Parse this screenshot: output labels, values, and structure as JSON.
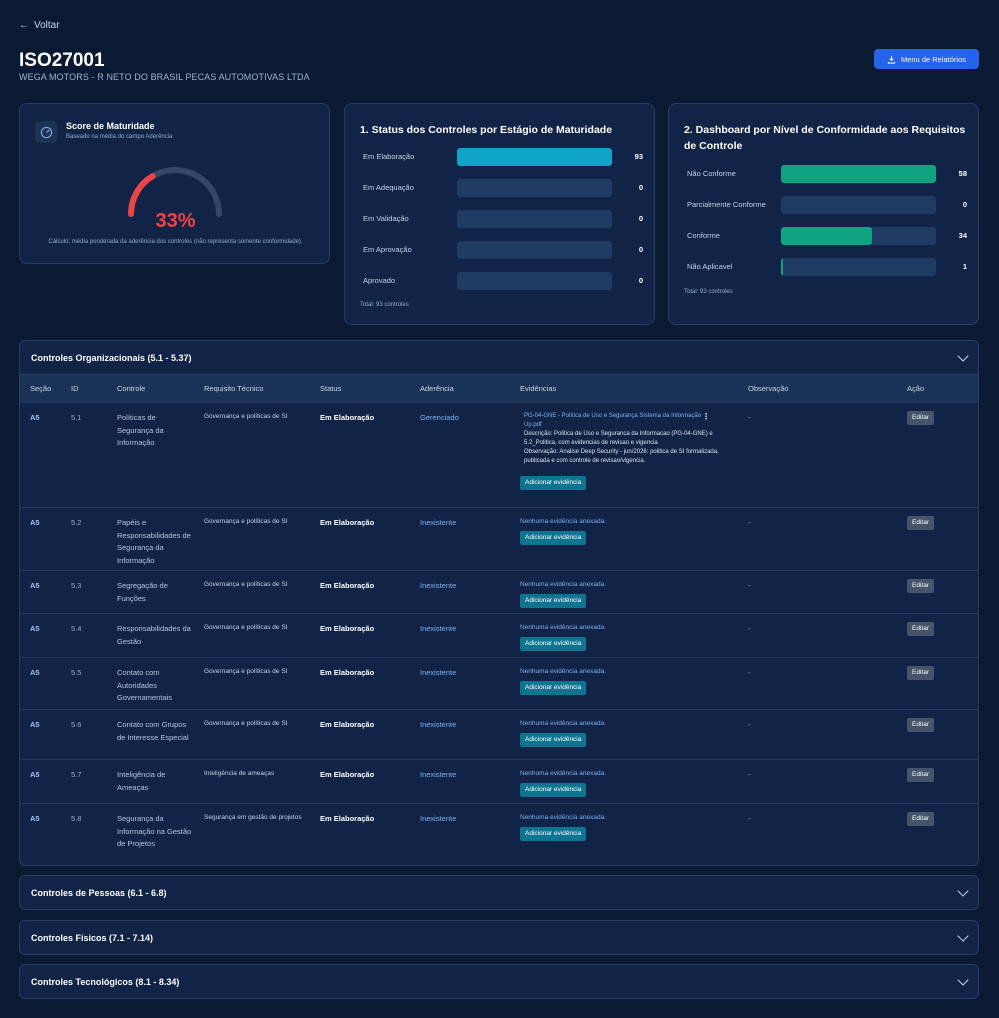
{
  "nav": {
    "back_label": "Voltar"
  },
  "header": {
    "title": "ISO27001",
    "company": "WEGA MOTORS - R NETO DO BRASIL PECAS AUTOMOTIVAS LTDA",
    "report_button": "Menu de Relatórios"
  },
  "score": {
    "title": "Score de Maturidade",
    "subtitle": "Baseado na média do campo Aderência",
    "value": "33%",
    "value_fraction": 0.33,
    "note": "Cálculo: média ponderada da aderência dos controles (não representa somente conformidade).",
    "color": "#ef4444"
  },
  "status_chart": {
    "title": "1. Status dos Controles por Estágio de Maturidade",
    "total": "Total: 93 controles",
    "max": 93,
    "color": "#0ea5c9",
    "rows": [
      {
        "label": "Em Elaboração",
        "value": 93
      },
      {
        "label": "Em Adequação",
        "value": 0
      },
      {
        "label": "Em Validação",
        "value": 0
      },
      {
        "label": "Em Aprovação",
        "value": 0
      },
      {
        "label": "Aprovado",
        "value": 0
      }
    ]
  },
  "conformity_chart": {
    "title_line1": "2. Dashboard por Nível de Conformidade aos Requisitos",
    "title_line2": "de Controle",
    "total": "Total: 93 controles",
    "max": 58,
    "color": "#10a37f",
    "rows": [
      {
        "label": "Não Conforme",
        "value": 58
      },
      {
        "label": "Parcialmente Conforme",
        "value": 0
      },
      {
        "label": "Conforme",
        "value": 34
      },
      {
        "label": "Não Aplicavel",
        "value": 1
      }
    ]
  },
  "sections": {
    "org": {
      "title": "Controles Organizacionais (5.1 - 5.37)",
      "columns": [
        "Seção",
        "ID",
        "Controle",
        "Requisito Técnico",
        "Status",
        "Aderência",
        "Evidências",
        "Observação",
        "Ação"
      ],
      "rows": [
        {
          "sec": "A5",
          "id": "5.1",
          "control": "Políticas de Segurança da Informação",
          "req": "Governança e políticas de SI",
          "status": "Em Elaboração",
          "ader": "Gerenciado",
          "obs": "-",
          "evidence": {
            "file": "PG-04-GNE - Política de Uso e Segurança Sistema da Informação Up.pdf",
            "description": "Descrição: Politica de Uso e Seguranca da Informacao (PG-04-GNE) e 5.2_Politica, com evidencias de revisao e vigencia",
            "observation": "Observação: Analise Deep Security - jun/2026: politica de SI formalizada, publicada e com controle de revisao/vigencia."
          }
        },
        {
          "sec": "A5",
          "id": "5.2",
          "control": "Papéis e Responsabilidades de Segurança da Informação",
          "req": "Governança e políticas de SI",
          "status": "Em Elaboração",
          "ader": "Inexistente",
          "obs": "-"
        },
        {
          "sec": "A5",
          "id": "5.3",
          "control": "Segregação de Funções",
          "req": "Governança e políticas de SI",
          "status": "Em Elaboração",
          "ader": "Inexistente",
          "obs": "-"
        },
        {
          "sec": "A5",
          "id": "5.4",
          "control": "Responsabilidades da Gestão",
          "req": "Governança e políticas de SI",
          "status": "Em Elaboração",
          "ader": "Inexistente",
          "obs": "-"
        },
        {
          "sec": "A5",
          "id": "5.5",
          "control": "Contato com Autoridades Governamentais",
          "req": "Governança e políticas de SI",
          "status": "Em Elaboração",
          "ader": "Inexistente",
          "obs": "-"
        },
        {
          "sec": "A5",
          "id": "5.6",
          "control": "Contato com Grupos de Interesse Especial",
          "req": "Governança e políticas de SI",
          "status": "Em Elaboração",
          "ader": "Inexistente",
          "obs": "-"
        },
        {
          "sec": "A5",
          "id": "5.7",
          "control": "Inteligência de Ameaças",
          "req": "Inteligência de ameaças",
          "status": "Em Elaboração",
          "ader": "Inexistente",
          "obs": "-"
        },
        {
          "sec": "A5",
          "id": "5.8",
          "control": "Segurança da Informação na Gestão de Projetos",
          "req": "Segurança em gestão de projetos",
          "status": "Em Elaboração",
          "ader": "Inexistente",
          "obs": "-"
        }
      ],
      "no_evidence": "Nenhuma evidência anexada.",
      "add_evidence": "Adicionar evidência",
      "edit": "Editar"
    },
    "people": {
      "title": "Controles de Pessoas (6.1 - 6.8)"
    },
    "physical": {
      "title": "Controles Físicos (7.1 - 7.14)"
    },
    "tech": {
      "title": "Controles Tecnológicos (8.1 - 8.34)"
    }
  }
}
